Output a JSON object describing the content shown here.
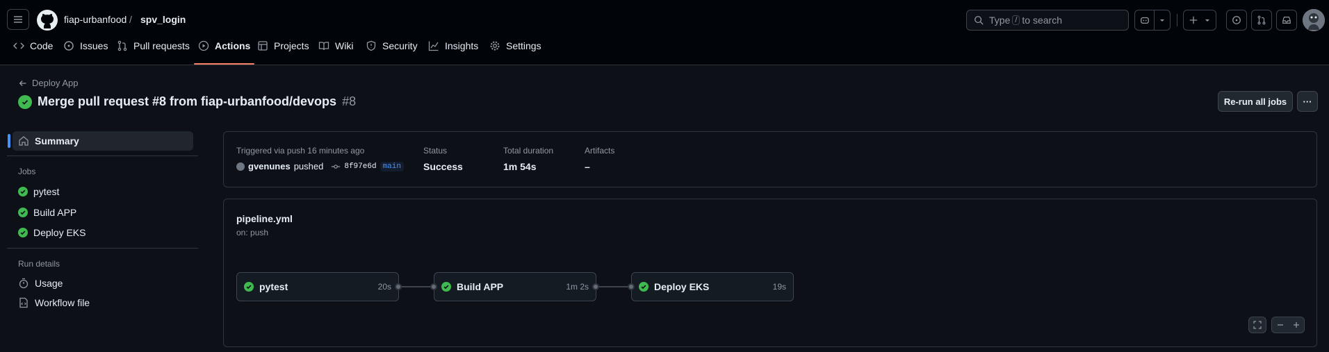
{
  "header": {
    "owner": "fiap-urbanfood",
    "separator": "/",
    "repo": "spv_login",
    "search": {
      "prefix": "Type",
      "key": "/",
      "suffix": "to search"
    },
    "tabs": [
      {
        "label": "Code",
        "icon": "code-icon"
      },
      {
        "label": "Issues",
        "icon": "issue-icon"
      },
      {
        "label": "Pull requests",
        "icon": "pull-request-icon"
      },
      {
        "label": "Actions",
        "icon": "play-icon"
      },
      {
        "label": "Projects",
        "icon": "table-icon"
      },
      {
        "label": "Wiki",
        "icon": "book-icon"
      },
      {
        "label": "Security",
        "icon": "shield-icon"
      },
      {
        "label": "Insights",
        "icon": "graph-icon"
      },
      {
        "label": "Settings",
        "icon": "gear-icon"
      }
    ]
  },
  "run": {
    "back_label": "Deploy App",
    "title": "Merge pull request #8 from fiap-urbanfood/devops",
    "number": "#8",
    "rerun_label": "Re-run all jobs",
    "more_label": "···"
  },
  "sidebar": {
    "summary": "Summary",
    "jobs_heading": "Jobs",
    "jobs": [
      "pytest",
      "Build APP",
      "Deploy EKS"
    ],
    "details_heading": "Run details",
    "usage": "Usage",
    "workflow_file": "Workflow file"
  },
  "summary": {
    "triggered": "Triggered via push 16 minutes ago",
    "actor": "gvenunes",
    "action": "pushed",
    "commit": "8f97e6d",
    "branch": "main",
    "status_label": "Status",
    "status_value": "Success",
    "duration_label": "Total duration",
    "duration_value": "1m 54s",
    "artifacts_label": "Artifacts",
    "artifacts_value": "–"
  },
  "workflow": {
    "file": "pipeline.yml",
    "trigger": "on: push",
    "jobs": [
      {
        "name": "pytest",
        "duration": "20s"
      },
      {
        "name": "Build APP",
        "duration": "1m 2s"
      },
      {
        "name": "Deploy EKS",
        "duration": "19s"
      }
    ]
  },
  "colors": {
    "accent": "#f78166",
    "success": "#3fb950",
    "branch": "#4493f8"
  }
}
